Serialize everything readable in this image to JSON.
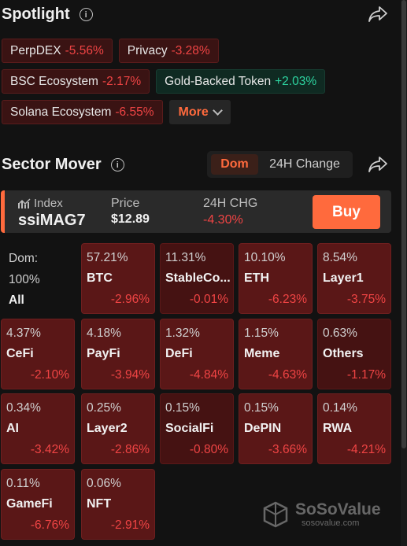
{
  "spotlight": {
    "title": "Spotlight",
    "tags": [
      {
        "name": "PerpDEX",
        "change": "-5.56%",
        "trend": "down"
      },
      {
        "name": "Privacy",
        "change": "-3.28%",
        "trend": "down"
      },
      {
        "name": "BSC Ecosystem",
        "change": "-2.17%",
        "trend": "down"
      },
      {
        "name": "Gold-Backed Token",
        "change": "+2.03%",
        "trend": "up"
      },
      {
        "name": "Solana Ecosystem",
        "change": "-6.55%",
        "trend": "down"
      }
    ],
    "more_label": "More"
  },
  "sector": {
    "title": "Sector Mover",
    "toggle": {
      "active": "Dom",
      "inactive": "24H Change"
    },
    "index": {
      "label": "Index",
      "name": "ssiMAG7",
      "price_label": "Price",
      "price": "$12.89",
      "change_label": "24H CHG",
      "change": "-4.30%",
      "buy_label": "Buy"
    },
    "summary": {
      "label": "Dom:",
      "value": "100%",
      "name": "All"
    },
    "cells": [
      {
        "dom": "57.21%",
        "name": "BTC",
        "change": "-2.96%"
      },
      {
        "dom": "11.31%",
        "name": "StableCo...",
        "change": "-0.01%"
      },
      {
        "dom": "10.10%",
        "name": "ETH",
        "change": "-6.23%"
      },
      {
        "dom": "8.54%",
        "name": "Layer1",
        "change": "-3.75%"
      },
      {
        "dom": "4.37%",
        "name": "CeFi",
        "change": "-2.10%"
      },
      {
        "dom": "4.18%",
        "name": "PayFi",
        "change": "-3.94%"
      },
      {
        "dom": "1.32%",
        "name": "DeFi",
        "change": "-4.84%"
      },
      {
        "dom": "1.15%",
        "name": "Meme",
        "change": "-4.63%"
      },
      {
        "dom": "0.63%",
        "name": "Others",
        "change": "-1.17%"
      },
      {
        "dom": "0.34%",
        "name": "AI",
        "change": "-3.42%"
      },
      {
        "dom": "0.25%",
        "name": "Layer2",
        "change": "-2.86%"
      },
      {
        "dom": "0.15%",
        "name": "SocialFi",
        "change": "-0.80%"
      },
      {
        "dom": "0.15%",
        "name": "DePIN",
        "change": "-3.66%"
      },
      {
        "dom": "0.14%",
        "name": "RWA",
        "change": "-4.21%"
      },
      {
        "dom": "0.11%",
        "name": "GameFi",
        "change": "-6.76%"
      },
      {
        "dom": "0.06%",
        "name": "NFT",
        "change": "-2.91%"
      }
    ]
  },
  "watermark": {
    "brand": "SoSoValue",
    "url": "sosovalue.com"
  },
  "colors": {
    "accent": "#ff6a3d",
    "down": "#ef4444",
    "up": "#2dd4a0"
  },
  "icons": [
    "info-icon",
    "share-icon",
    "chart-icon",
    "chevron-down-icon",
    "logo-icon"
  ]
}
